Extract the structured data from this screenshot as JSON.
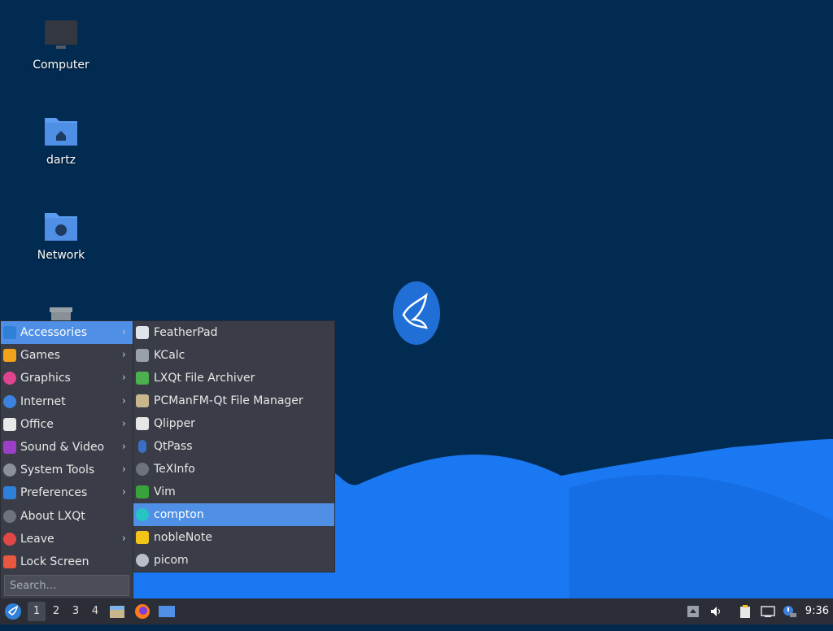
{
  "desktop": {
    "icons": [
      {
        "label": "Computer",
        "icon": "computer-icon"
      },
      {
        "label": "dartz",
        "icon": "home-folder-icon"
      },
      {
        "label": "Network",
        "icon": "network-folder-icon"
      },
      {
        "label": "",
        "icon": "trash-icon"
      }
    ],
    "colors": {
      "background": "#022b52",
      "wave": "#1a78f2",
      "accent": "#4f8fe6"
    }
  },
  "menu": {
    "categories": [
      {
        "label": "Accessories",
        "icon": "accessories-icon",
        "submenu": true,
        "selected": true
      },
      {
        "label": "Games",
        "icon": "games-icon",
        "submenu": true
      },
      {
        "label": "Graphics",
        "icon": "graphics-icon",
        "submenu": true
      },
      {
        "label": "Internet",
        "icon": "internet-icon",
        "submenu": true
      },
      {
        "label": "Office",
        "icon": "office-icon",
        "submenu": true
      },
      {
        "label": "Sound & Video",
        "icon": "sound-video-icon",
        "submenu": true
      },
      {
        "label": "System Tools",
        "icon": "system-tools-icon",
        "submenu": true
      },
      {
        "label": "Preferences",
        "icon": "preferences-icon",
        "submenu": true
      },
      {
        "label": "About LXQt",
        "icon": "info-icon",
        "submenu": false
      },
      {
        "label": "Leave",
        "icon": "power-icon",
        "submenu": true
      },
      {
        "label": "Lock Screen",
        "icon": "lock-icon",
        "submenu": false
      }
    ],
    "search_placeholder": "Search...",
    "submenu_arrow": "›"
  },
  "submenu": {
    "items": [
      {
        "label": "FeatherPad",
        "icon": "featherpad-icon"
      },
      {
        "label": "KCalc",
        "icon": "calculator-icon"
      },
      {
        "label": "LXQt File Archiver",
        "icon": "archiver-icon"
      },
      {
        "label": "PCManFM-Qt File Manager",
        "icon": "file-manager-icon"
      },
      {
        "label": "Qlipper",
        "icon": "clipboard-icon"
      },
      {
        "label": "QtPass",
        "icon": "key-icon"
      },
      {
        "label": "TeXInfo",
        "icon": "info-icon"
      },
      {
        "label": "Vim",
        "icon": "vim-icon"
      },
      {
        "label": "compton",
        "icon": "compton-icon",
        "selected": true
      },
      {
        "label": "nobleNote",
        "icon": "note-icon"
      },
      {
        "label": "picom",
        "icon": "gear-icon"
      }
    ]
  },
  "panel": {
    "workspaces": [
      "1",
      "2",
      "3",
      "4"
    ],
    "active_workspace": "1",
    "clock": "9:36",
    "launchers": [
      "file-manager-icon",
      "firefox-icon",
      "show-desktop-icon"
    ],
    "tray": [
      "eject-icon",
      "volume-icon",
      "clipboard-icon",
      "network-wired-icon",
      "update-notifier-icon"
    ]
  }
}
